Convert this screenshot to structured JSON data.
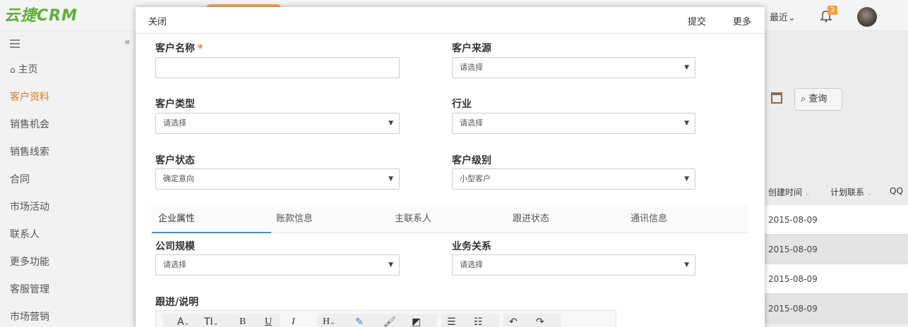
{
  "app": {
    "logo": "云捷CRM",
    "recent": "最近",
    "notif_count": "2"
  },
  "sidebar": {
    "items": [
      {
        "label": "主页"
      },
      {
        "label": "客户资料"
      },
      {
        "label": "销售机会"
      },
      {
        "label": "销售线索"
      },
      {
        "label": "合同"
      },
      {
        "label": "市场活动"
      },
      {
        "label": "联系人"
      },
      {
        "label": "更多功能"
      },
      {
        "label": "客服管理"
      },
      {
        "label": "市场营销"
      }
    ]
  },
  "background": {
    "query_label": "查询",
    "columns": [
      "创建时间",
      "计划联系",
      "QQ"
    ],
    "dates": [
      "2015-08-09",
      "2015-08-09",
      "2015-08-09",
      "2015-08-09"
    ]
  },
  "modal": {
    "close": "关闭",
    "submit": "提交",
    "more": "更多",
    "fields": {
      "customer_name": {
        "label": "客户名称",
        "required_mark": "*",
        "value": ""
      },
      "customer_source": {
        "label": "客户来源",
        "value": "请选择"
      },
      "customer_type": {
        "label": "客户类型",
        "value": "请选择"
      },
      "industry": {
        "label": "行业",
        "value": "请选择"
      },
      "customer_status": {
        "label": "客户状态",
        "value": "确定意向"
      },
      "customer_level": {
        "label": "客户级别",
        "value": "小型客户"
      },
      "company_size": {
        "label": "公司规模",
        "value": "请选择"
      },
      "business_relation": {
        "label": "业务关系",
        "value": "请选择"
      },
      "followup": {
        "label": "跟进/说明"
      }
    },
    "tabs": [
      "企业属性",
      "账款信息",
      "主联系人",
      "跟进状态",
      "通讯信息"
    ],
    "toolbar": {
      "font": "A",
      "size": "TI",
      "bold": "B",
      "underline": "U",
      "italic": "I",
      "heading": "H"
    }
  }
}
